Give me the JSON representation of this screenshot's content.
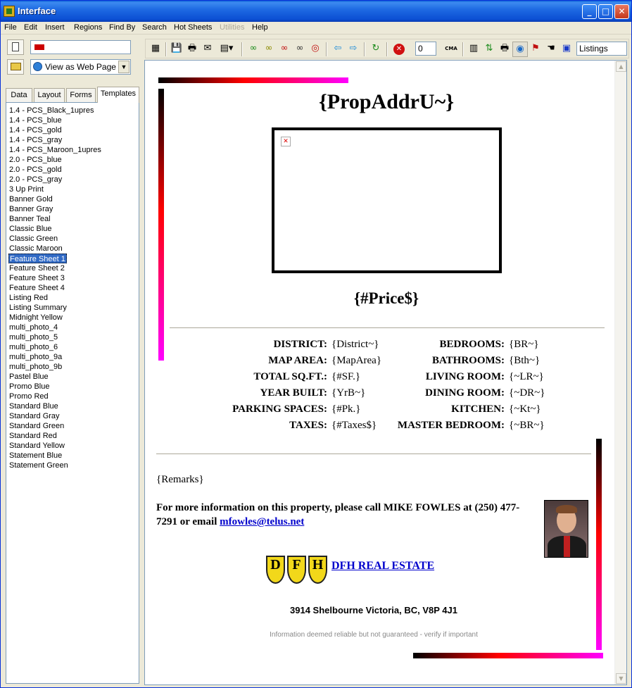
{
  "window": {
    "title": "Interface"
  },
  "menu": [
    {
      "label": "File",
      "enabled": true
    },
    {
      "label": "Edit",
      "enabled": true
    },
    {
      "label": "Insert",
      "enabled": true
    },
    {
      "label": "Regions",
      "enabled": true
    },
    {
      "label": "Find By",
      "enabled": true
    },
    {
      "label": "Search",
      "enabled": true
    },
    {
      "label": "Hot Sheets",
      "enabled": true
    },
    {
      "label": "Utilities",
      "enabled": false
    },
    {
      "label": "Help",
      "enabled": true
    }
  ],
  "left": {
    "view_select": "View as Web Page",
    "tabs": [
      "Data",
      "Layout",
      "Forms",
      "Templates"
    ],
    "active_tab": "Templates",
    "templates": [
      "1.4 - PCS_Black_1upres",
      "1.4 - PCS_blue",
      "1.4 - PCS_gold",
      "1.4 - PCS_gray",
      "1.4 - PCS_Maroon_1upres",
      "2.0 - PCS_blue",
      "2.0 - PCS_gold",
      "2.0 - PCS_gray",
      "3 Up Print",
      "Banner Gold",
      "Banner Gray",
      "Banner Teal",
      "Classic Blue",
      "Classic Green",
      "Classic Maroon",
      "Feature Sheet 1",
      "Feature Sheet 2",
      "Feature Sheet 3",
      "Feature Sheet 4",
      "Listing Red",
      "Listing Summary",
      "Midnight Yellow",
      "multi_photo_4",
      "multi_photo_5",
      "multi_photo_6",
      "multi_photo_9a",
      "multi_photo_9b",
      "Pastel Blue",
      "Promo Blue",
      "Promo Red",
      "Standard Blue",
      "Standard Gray",
      "Standard Green",
      "Standard Red",
      "Standard Yellow",
      "Statement Blue",
      "Statement Green"
    ],
    "selected_template": "Feature Sheet 1"
  },
  "toolbar": {
    "count_value": "0",
    "cma_label": "CMA",
    "mode_select": "Listings"
  },
  "sheet": {
    "title": "{PropAddrU~}",
    "price": "{#Price$}",
    "details_left": [
      {
        "label": "DISTRICT:",
        "value": "{District~}"
      },
      {
        "label": "MAP AREA:",
        "value": "{MapArea}"
      },
      {
        "label": "TOTAL SQ.FT.:",
        "value": "{#SF.}"
      },
      {
        "label": "YEAR BUILT:",
        "value": "{YrB~}"
      },
      {
        "label": "PARKING SPACES:",
        "value": "{#Pk.}"
      },
      {
        "label": "TAXES:",
        "value": "{#Taxes$}"
      }
    ],
    "details_right": [
      {
        "label": "BEDROOMS:",
        "value": "{BR~}"
      },
      {
        "label": "BATHROOMS:",
        "value": "{Bth~}"
      },
      {
        "label": "LIVING ROOM:",
        "value": "{~LR~}"
      },
      {
        "label": "DINING ROOM:",
        "value": "{~DR~}"
      },
      {
        "label": "KITCHEN:",
        "value": "{~Kt~}"
      },
      {
        "label": "MASTER BEDROOM:",
        "value": "{~BR~}"
      }
    ],
    "remarks": "{Remarks}",
    "contact_text": "For more information on this property, please call MIKE FOWLES at (250) 477-7291 or email ",
    "email": "mfowles@telus.net",
    "company": "DFH REAL ESTATE",
    "logo_letters": [
      "D",
      "F",
      "H"
    ],
    "address": "3914 Shelbourne Victoria, BC, V8P 4J1",
    "disclaimer": "Information deemed reliable but not guaranteed - verify if important"
  }
}
